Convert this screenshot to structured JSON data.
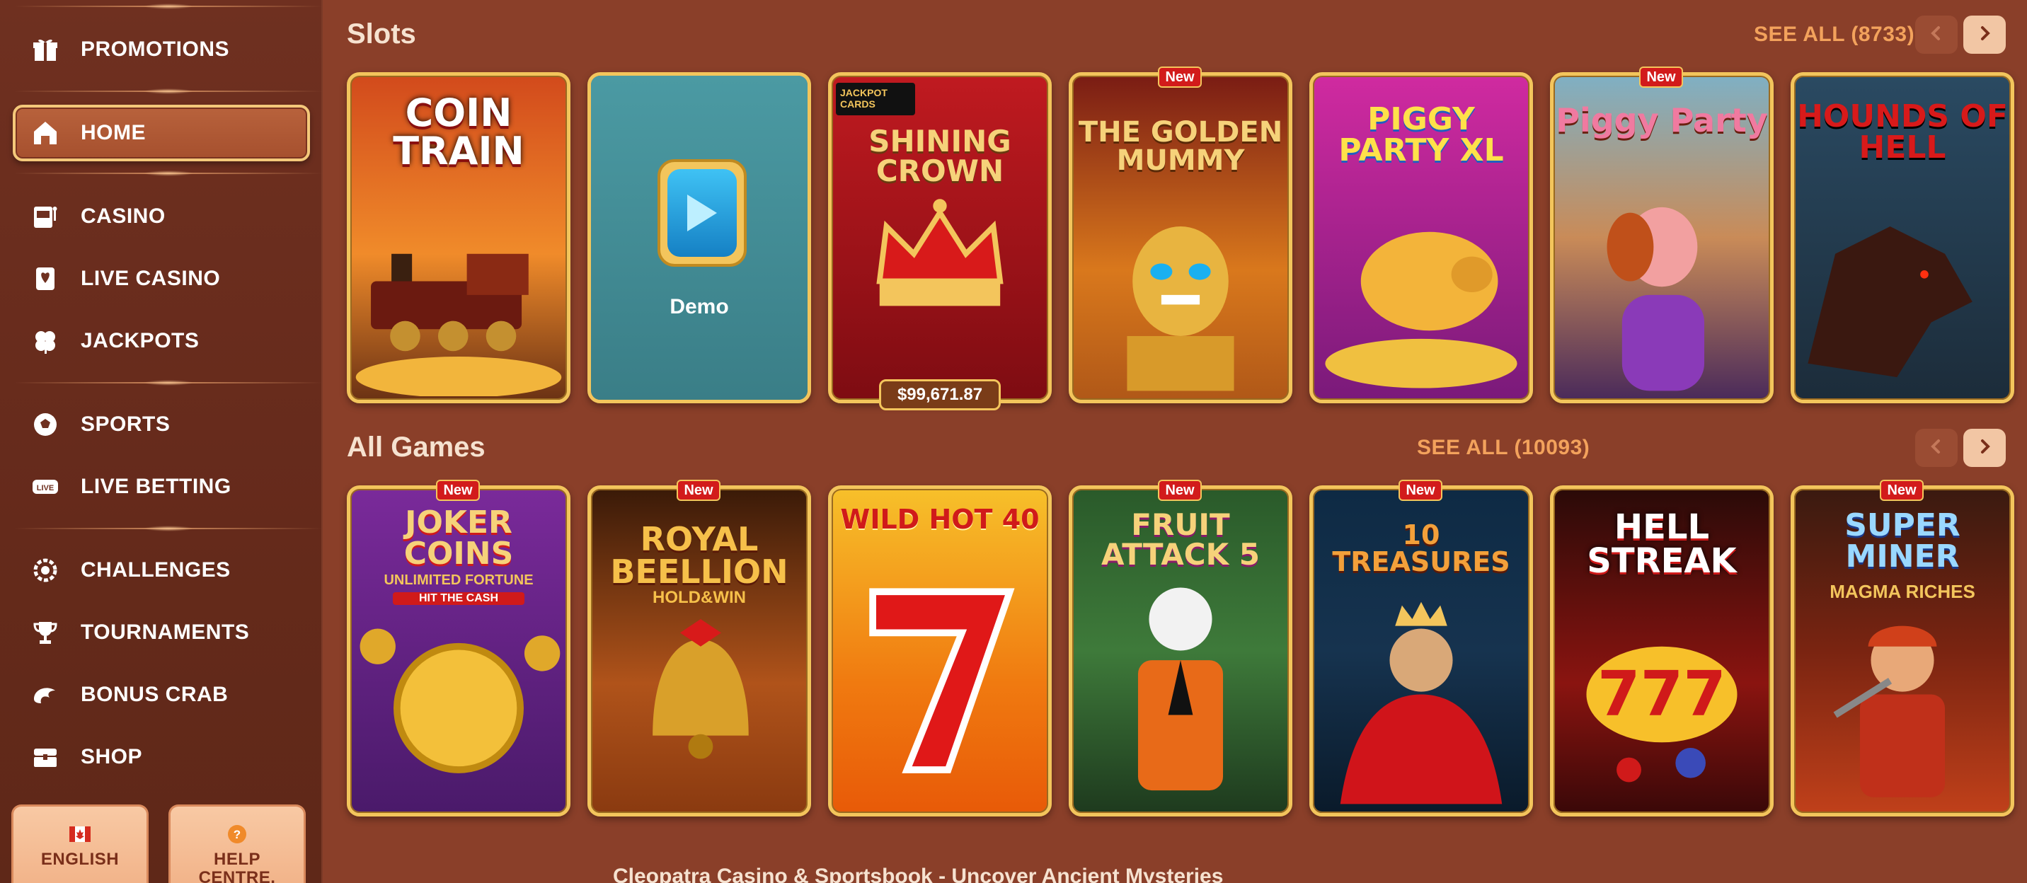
{
  "sidebar": {
    "items": [
      {
        "label": "PROMOTIONS",
        "icon": "gift-icon"
      },
      {
        "label": "HOME",
        "icon": "home-icon",
        "active": true
      },
      {
        "label": "CASINO",
        "icon": "slot-machine-icon"
      },
      {
        "label": "LIVE CASINO",
        "icon": "playing-card-icon"
      },
      {
        "label": "JACKPOTS",
        "icon": "clover-icon"
      },
      {
        "label": "SPORTS",
        "icon": "soccer-ball-icon"
      },
      {
        "label": "LIVE BETTING",
        "icon": "live-badge-icon"
      },
      {
        "label": "CHALLENGES",
        "icon": "badge-icon"
      },
      {
        "label": "TOURNAMENTS",
        "icon": "trophy-icon"
      },
      {
        "label": "BONUS CRAB",
        "icon": "crab-icon"
      },
      {
        "label": "SHOP",
        "icon": "treasure-chest-icon"
      }
    ],
    "language_label": "ENGLISH",
    "help_label": "HELP CENTRE.",
    "live_icon_text": "LIVE"
  },
  "slots": {
    "title": "Slots",
    "see_all": "SEE ALL (8733)",
    "jackpot": "$99,671.87",
    "demo_label": "Demo",
    "new_label": "New",
    "games": [
      {
        "name": "COIN TRAIN",
        "bg": "#c8461c",
        "new": false
      },
      {
        "name": "Demo",
        "bg": "#3f8e97",
        "new": false
      },
      {
        "name": "SHINING CROWN",
        "bg": "#a9141a",
        "new": false
      },
      {
        "name": "THE GOLDEN MUMMY",
        "bg": "#b8611c",
        "new": true
      },
      {
        "name": "PIGGY PARTY XL",
        "bg": "#b51f8a",
        "new": false
      },
      {
        "name": "Piggy Party",
        "bg": "#c98b58",
        "new": true
      },
      {
        "name": "HOUNDS OF HELL",
        "bg": "#30526a",
        "new": false
      }
    ],
    "jackpot_logo": "JACKPOT CARDS"
  },
  "all_games": {
    "title": "All Games",
    "see_all": "SEE ALL (10093)",
    "new_label": "New",
    "games": [
      {
        "name": "JOKER COINS",
        "sub": "UNLIMITED FORTUNE",
        "sub2": "HIT THE CASH",
        "bg": "#6c2b8d",
        "new": true
      },
      {
        "name": "ROYAL BEELLION",
        "sub": "HOLD&WIN",
        "bg": "#b0531a",
        "new": true
      },
      {
        "name": "WILD HOT 40",
        "bg": "#f08a12",
        "new": false
      },
      {
        "name": "FRUIT ATTACK 5",
        "bg": "#3e7a3a",
        "new": true
      },
      {
        "name": "10 TREASURES",
        "bg": "#16334f",
        "new": true
      },
      {
        "name": "HELL STREAK",
        "bg": "#8a1410",
        "new": false
      },
      {
        "name": "SUPER MINER",
        "sub": "MAGMA RICHES",
        "bg": "#7a2411",
        "new": true
      }
    ]
  },
  "footer": {
    "text": "Cleopatra Casino & Sportsbook - Uncover Ancient Mysteries"
  }
}
